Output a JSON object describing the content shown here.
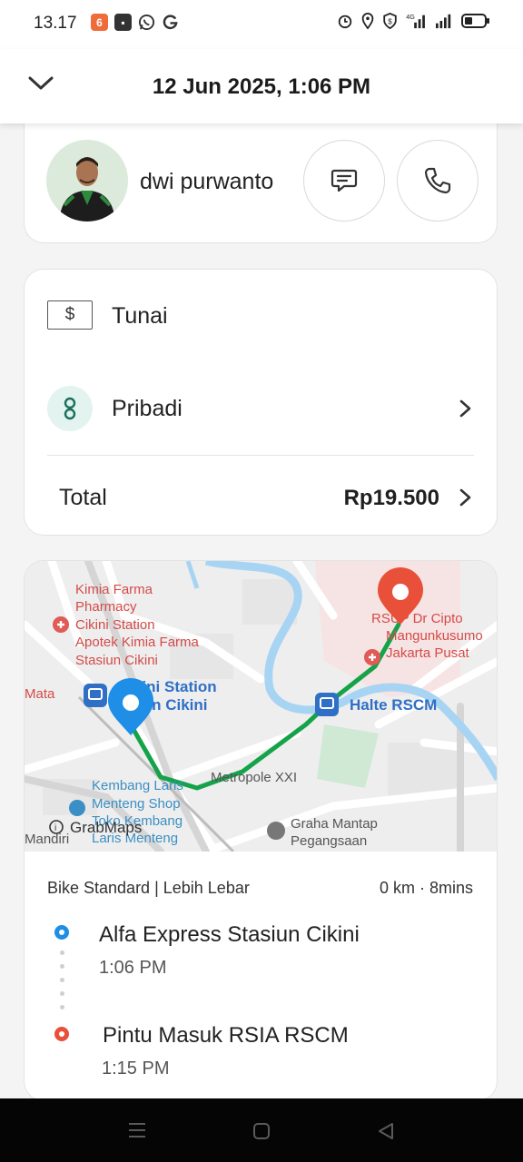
{
  "status_bar": {
    "time": "13.17",
    "left_icons": [
      "shop-notification-icon",
      "chat-app-icon",
      "whatsapp-icon",
      "google-icon"
    ],
    "right_icons": [
      "alarm-icon",
      "location-icon",
      "shield-icon",
      "4g-signal-icon",
      "signal-icon",
      "battery-icon"
    ],
    "network": "4G"
  },
  "header": {
    "title": "12 Jun 2025, 1:06 PM",
    "collapse_icon": "chevron-down-icon"
  },
  "driver": {
    "name": "dwi purwanto",
    "chat_icon": "chat-icon",
    "call_icon": "phone-icon"
  },
  "payment": {
    "method_symbol": "$",
    "method": "Tunai",
    "profile": "Pribadi",
    "total_label": "Total",
    "total_amount": "Rp19.500"
  },
  "map": {
    "labels": {
      "kimia_farma": [
        "Kimia Farma",
        "Pharmacy",
        "Cikini Station",
        "Apotek Kimia Farma",
        "Stasiun Cikini"
      ],
      "cikini_station": [
        "Cikini Station",
        "iun Cikini"
      ],
      "rscm": [
        "RSUP Dr Cipto",
        "Mangunkusumo",
        "Jakarta Pusat"
      ],
      "halte": "Halte RSCM",
      "metropole": "Metropole XXI",
      "kembang": [
        "Kembang Laris",
        "Menteng Shop",
        "Toko Kembang",
        "Laris Menteng"
      ],
      "graha": [
        "Graha Mantap",
        "Pegangsaan"
      ],
      "mata": "Mata",
      "mandiri": "Mandiri",
      "brand": "GrabMaps"
    },
    "route_color": "#15a34a",
    "pickup_color": "#1e8ee6",
    "dropoff_color": "#e8503a"
  },
  "trip": {
    "service": "Bike Standard | Lebih Lebar",
    "meta": "0 km · 8mins",
    "pickup": {
      "name": "Alfa Express Stasiun Cikini",
      "time": "1:06 PM"
    },
    "dropoff": {
      "name": "Pintu Masuk RSIA RSCM",
      "time": "1:15 PM"
    }
  },
  "nav_bar": {
    "buttons": [
      "menu-icon",
      "home-icon",
      "back-icon"
    ]
  }
}
